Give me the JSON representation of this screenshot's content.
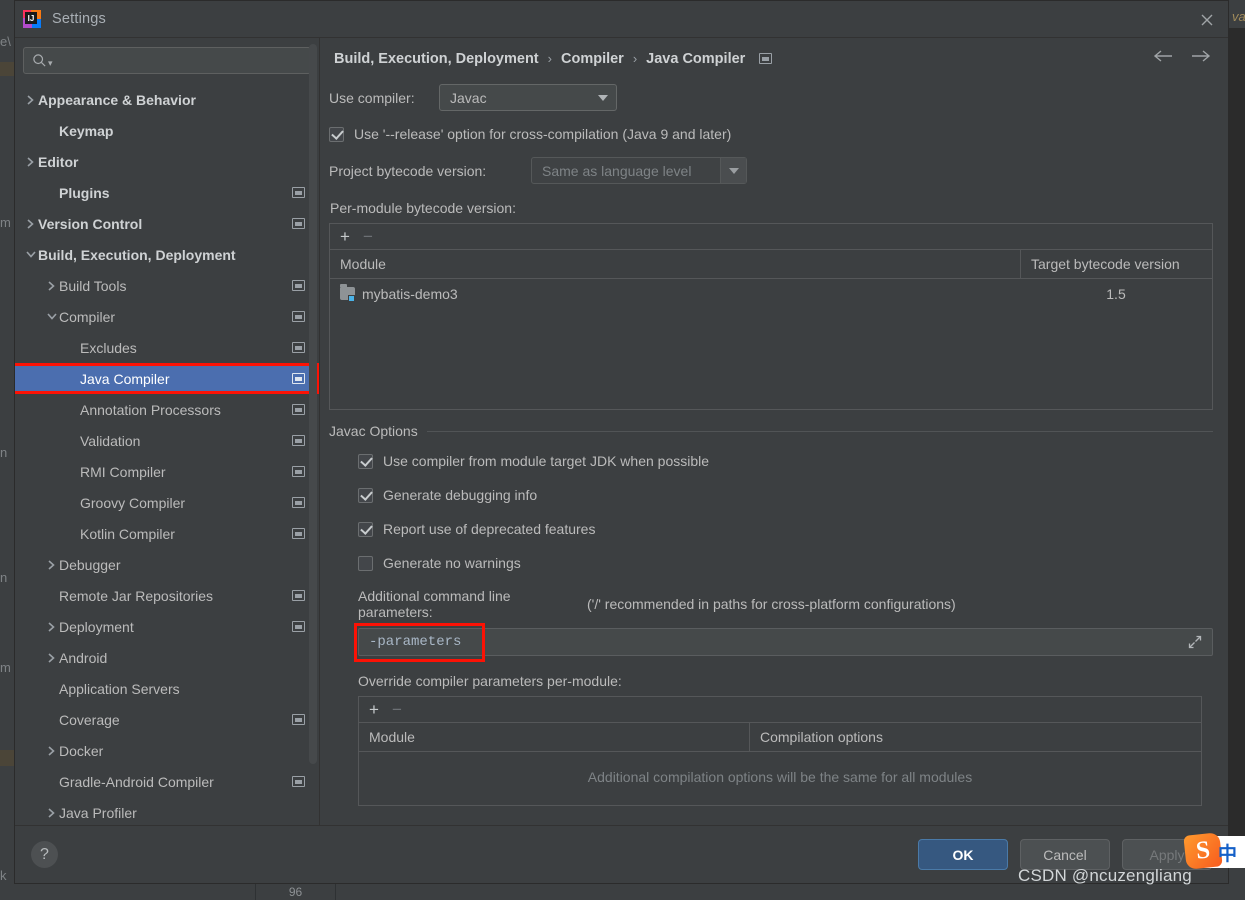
{
  "window": {
    "title": "Settings",
    "logo_icon": "intellij-idea-logo",
    "close_icon": "close-icon"
  },
  "sidebar": {
    "search": {
      "placeholder": "",
      "value": "",
      "icon": "search-icon"
    },
    "items": [
      {
        "label": "Appearance & Behavior",
        "indent": 0,
        "arrow": "right",
        "badge": false,
        "selected": false,
        "bold": true
      },
      {
        "label": "Keymap",
        "indent": 1,
        "arrow": "none",
        "badge": false,
        "selected": false,
        "bold": true
      },
      {
        "label": "Editor",
        "indent": 0,
        "arrow": "right",
        "badge": false,
        "selected": false,
        "bold": true
      },
      {
        "label": "Plugins",
        "indent": 1,
        "arrow": "none",
        "badge": true,
        "selected": false,
        "bold": true
      },
      {
        "label": "Version Control",
        "indent": 0,
        "arrow": "right",
        "badge": true,
        "selected": false,
        "bold": true
      },
      {
        "label": "Build, Execution, Deployment",
        "indent": 0,
        "arrow": "down",
        "badge": false,
        "selected": false,
        "bold": true
      },
      {
        "label": "Build Tools",
        "indent": 1,
        "arrow": "right",
        "badge": true,
        "selected": false,
        "bold": false
      },
      {
        "label": "Compiler",
        "indent": 1,
        "arrow": "down",
        "badge": true,
        "selected": false,
        "bold": false
      },
      {
        "label": "Excludes",
        "indent": 2,
        "arrow": "none",
        "badge": true,
        "selected": false,
        "bold": false
      },
      {
        "label": "Java Compiler",
        "indent": 2,
        "arrow": "none",
        "badge": true,
        "selected": true,
        "bold": false
      },
      {
        "label": "Annotation Processors",
        "indent": 2,
        "arrow": "none",
        "badge": true,
        "selected": false,
        "bold": false
      },
      {
        "label": "Validation",
        "indent": 2,
        "arrow": "none",
        "badge": true,
        "selected": false,
        "bold": false
      },
      {
        "label": "RMI Compiler",
        "indent": 2,
        "arrow": "none",
        "badge": true,
        "selected": false,
        "bold": false
      },
      {
        "label": "Groovy Compiler",
        "indent": 2,
        "arrow": "none",
        "badge": true,
        "selected": false,
        "bold": false
      },
      {
        "label": "Kotlin Compiler",
        "indent": 2,
        "arrow": "none",
        "badge": true,
        "selected": false,
        "bold": false
      },
      {
        "label": "Debugger",
        "indent": 1,
        "arrow": "right",
        "badge": false,
        "selected": false,
        "bold": false
      },
      {
        "label": "Remote Jar Repositories",
        "indent": 1,
        "arrow": "none",
        "badge": true,
        "selected": false,
        "bold": false
      },
      {
        "label": "Deployment",
        "indent": 1,
        "arrow": "right",
        "badge": true,
        "selected": false,
        "bold": false
      },
      {
        "label": "Android",
        "indent": 1,
        "arrow": "right",
        "badge": false,
        "selected": false,
        "bold": false
      },
      {
        "label": "Application Servers",
        "indent": 1,
        "arrow": "none",
        "badge": false,
        "selected": false,
        "bold": false
      },
      {
        "label": "Coverage",
        "indent": 1,
        "arrow": "none",
        "badge": true,
        "selected": false,
        "bold": false
      },
      {
        "label": "Docker",
        "indent": 1,
        "arrow": "right",
        "badge": false,
        "selected": false,
        "bold": false
      },
      {
        "label": "Gradle-Android Compiler",
        "indent": 1,
        "arrow": "none",
        "badge": true,
        "selected": false,
        "bold": false
      },
      {
        "label": "Java Profiler",
        "indent": 1,
        "arrow": "right",
        "badge": false,
        "selected": false,
        "bold": false
      }
    ]
  },
  "breadcrumb": {
    "crumbs": [
      "Build, Execution, Deployment",
      "Compiler",
      "Java Compiler"
    ],
    "separator": "›",
    "badge_icon": "project-scope-icon",
    "back_icon": "arrow-left-icon",
    "forward_icon": "arrow-right-icon"
  },
  "main": {
    "use_compiler_label": "Use compiler:",
    "use_compiler_value": "Javac",
    "release_option_label": "Use '--release' option for cross-compilation (Java 9 and later)",
    "release_option_checked": true,
    "project_bytecode_label": "Project bytecode version:",
    "project_bytecode_value": "Same as language level",
    "per_module_label": "Per-module bytecode version:",
    "bytecode_table": {
      "add_label": "+",
      "remove_label": "−",
      "columns": [
        "Module",
        "Target bytecode version"
      ],
      "rows": [
        {
          "module": "mybatis-demo3",
          "version": "1.5",
          "icon": "module-folder-icon"
        }
      ]
    },
    "javac_options_title": "Javac Options",
    "javac_checkboxes": [
      {
        "label": "Use compiler from module target JDK when possible",
        "checked": true
      },
      {
        "label": "Generate debugging info",
        "checked": true
      },
      {
        "label": "Report use of deprecated features",
        "checked": true
      },
      {
        "label": "Generate no warnings",
        "checked": false
      }
    ],
    "additional_params_label": "Additional command line parameters:",
    "additional_params_hint": "('/' recommended in paths for cross-platform configurations)",
    "additional_params_value": "-parameters",
    "expand_icon": "expand-icon",
    "override_label": "Override compiler parameters per-module:",
    "override_table": {
      "add_label": "+",
      "remove_label": "−",
      "columns": [
        "Module",
        "Compilation options"
      ],
      "empty_text": "Additional compilation options will be the same for all modules"
    }
  },
  "footer": {
    "help_label": "?",
    "ok_label": "OK",
    "cancel_label": "Cancel",
    "apply_label": "Apply"
  },
  "overlay": {
    "watermark": "CSDN @ncuzengliang",
    "ime_logo": "S",
    "ime_mode": "中"
  },
  "background": {
    "fragments": [
      "e\\",
      "m",
      "m",
      "n",
      "m",
      "k",
      "va"
    ],
    "status_value": "96"
  },
  "colors": {
    "dialog_bg": "#3c3f41",
    "selection": "#4b6eaf",
    "highlight_red": "#fc1205",
    "primary_button": "#365880",
    "field_bg": "#45494a"
  }
}
